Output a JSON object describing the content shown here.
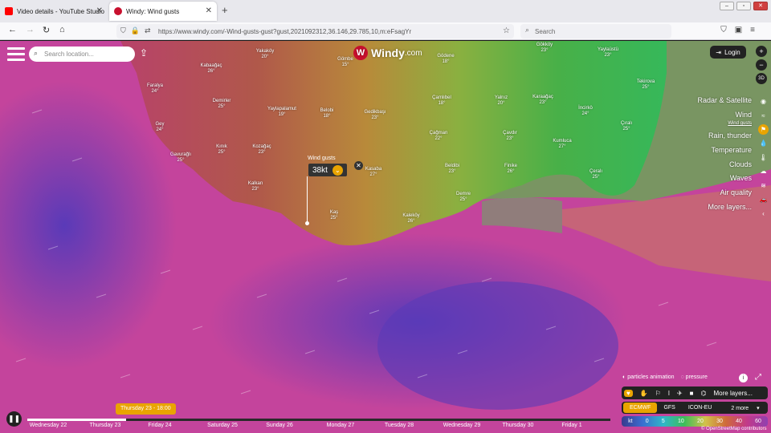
{
  "browser": {
    "tabs": [
      {
        "title": "Video details - YouTube Studio",
        "favicon_color": "#ff0000"
      },
      {
        "title": "Windy: Wind gusts",
        "favicon_color": "#c8102e"
      }
    ],
    "url": "https://www.windy.com/-Wind-gusts-gust?gust,2021092312,36.146,29.785,10,m:eFsagYr",
    "search_placeholder": "Search"
  },
  "windy": {
    "logo_text": "Windy",
    "logo_suffix": ".com",
    "search_placeholder": "Search location...",
    "login_label": "Login",
    "zoom": {
      "plus": "+",
      "minus": "−",
      "view3d": "3D"
    },
    "layers": [
      {
        "label": "Radar & Satellite",
        "icon": "satellite-icon"
      },
      {
        "label": "Wind",
        "icon": "wind-icon"
      },
      {
        "label": "Wind gusts",
        "icon": "gust-icon",
        "active": true
      },
      {
        "label": "Rain, thunder",
        "icon": "rain-icon"
      },
      {
        "label": "Temperature",
        "icon": "thermometer-icon"
      },
      {
        "label": "Clouds",
        "icon": "cloud-icon"
      },
      {
        "label": "Waves",
        "icon": "waves-icon"
      },
      {
        "label": "Air quality",
        "icon": "car-icon"
      },
      {
        "label": "More layers...",
        "icon": "chevron-left-icon"
      }
    ],
    "picker": {
      "label": "Wind gusts",
      "value": "38kt"
    },
    "cities": [
      {
        "name": "Yakaköy",
        "temp": "20°"
      },
      {
        "name": "Gömbe",
        "temp": "15°"
      },
      {
        "name": "Gödene",
        "temp": "18°"
      },
      {
        "name": "Gökköy",
        "temp": "23°"
      },
      {
        "name": "Yaylaüstü",
        "temp": "23°"
      },
      {
        "name": "Kabaağaç",
        "temp": "26°"
      },
      {
        "name": "Faralya",
        "temp": "24°"
      },
      {
        "name": "Demirler",
        "temp": "25°"
      },
      {
        "name": "Yaylapalamut",
        "temp": "19°"
      },
      {
        "name": "Belobi",
        "temp": "18°"
      },
      {
        "name": "Gedikbaşı",
        "temp": "23°"
      },
      {
        "name": "Çamlıbel",
        "temp": "18°"
      },
      {
        "name": "Yalnız",
        "temp": "20°"
      },
      {
        "name": "Karaağaç",
        "temp": "23°"
      },
      {
        "name": "İncirkö",
        "temp": "24°"
      },
      {
        "name": "Tekirova",
        "temp": "25°"
      },
      {
        "name": "Gey",
        "temp": "24°"
      },
      {
        "name": "Çağman",
        "temp": "22°"
      },
      {
        "name": "Çavdır",
        "temp": "23°"
      },
      {
        "name": "Kumluca",
        "temp": "27°"
      },
      {
        "name": "Çıralı",
        "temp": "25°"
      },
      {
        "name": "Gavurağlı",
        "temp": "25°"
      },
      {
        "name": "Kınık",
        "temp": "25°"
      },
      {
        "name": "Kozağaç",
        "temp": "23°"
      },
      {
        "name": "Kasaba",
        "temp": "27°"
      },
      {
        "name": "Beldibi",
        "temp": "23°"
      },
      {
        "name": "Finike",
        "temp": "26°"
      },
      {
        "name": "Çeralı",
        "temp": "25°"
      },
      {
        "name": "Kalkan",
        "temp": "23°"
      },
      {
        "name": "Demre",
        "temp": "25°"
      },
      {
        "name": "Kaş",
        "temp": "25°"
      },
      {
        "name": "Kaleköy",
        "temp": "26°"
      }
    ],
    "toggles": {
      "particles": "particles animation",
      "pressure": "pressure"
    },
    "icon_bar": {
      "more": "More layers..."
    },
    "models": [
      "ECMWF",
      "GFS",
      "ICON-EU",
      "2 more"
    ],
    "legend": {
      "unit": "kt",
      "stops": [
        "0",
        "5",
        "10",
        "20",
        "30",
        "40",
        "60"
      ]
    },
    "attribution": "© OpenStreetMap contributors",
    "timeline": {
      "current": "Thursday 23 - 18:00",
      "progress": 0.17,
      "days": [
        "Wednesday 22",
        "Thursday 23",
        "Friday 24",
        "Saturday 25",
        "Sunday 26",
        "Monday 27",
        "Tuesday 28",
        "Wednesday 29",
        "Thursday 30",
        "Friday 1"
      ]
    }
  },
  "colors": {
    "accent": "#e9a400",
    "sea_magenta": "#c0409a",
    "sea_purple": "#6a3ab0",
    "land_green": "#40b040",
    "land_brown": "#b07840"
  }
}
